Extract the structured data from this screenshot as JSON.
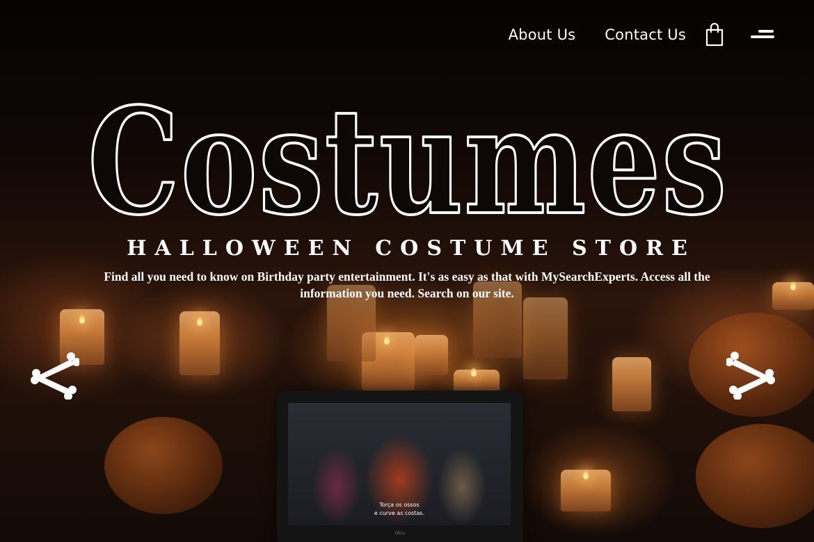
{
  "nav": {
    "about_label": "About Us",
    "contact_label": "Contact Us",
    "cart_icon": "shopping-bag-icon",
    "menu_icon": "hamburger-menu-icon"
  },
  "hero": {
    "title": "Costumes",
    "tagline": "HALLOWEEN COSTUME STORE",
    "description": "Find all you need to know on Birthday party entertainment. It's as easy as that with MySearchExperts. Access all the information you need. Search on our site.",
    "prev_icon": "bone-arrow-left-icon",
    "next_icon": "bone-arrow-right-icon"
  },
  "background": {
    "screen_subtitle_line1": "Torça os ossos",
    "screen_subtitle_line2": "e curve as costas.",
    "laptop_brand": "DELL"
  },
  "colors": {
    "text": "#ffffff",
    "background": "#0b0605",
    "candle_glow": "#d98840"
  }
}
